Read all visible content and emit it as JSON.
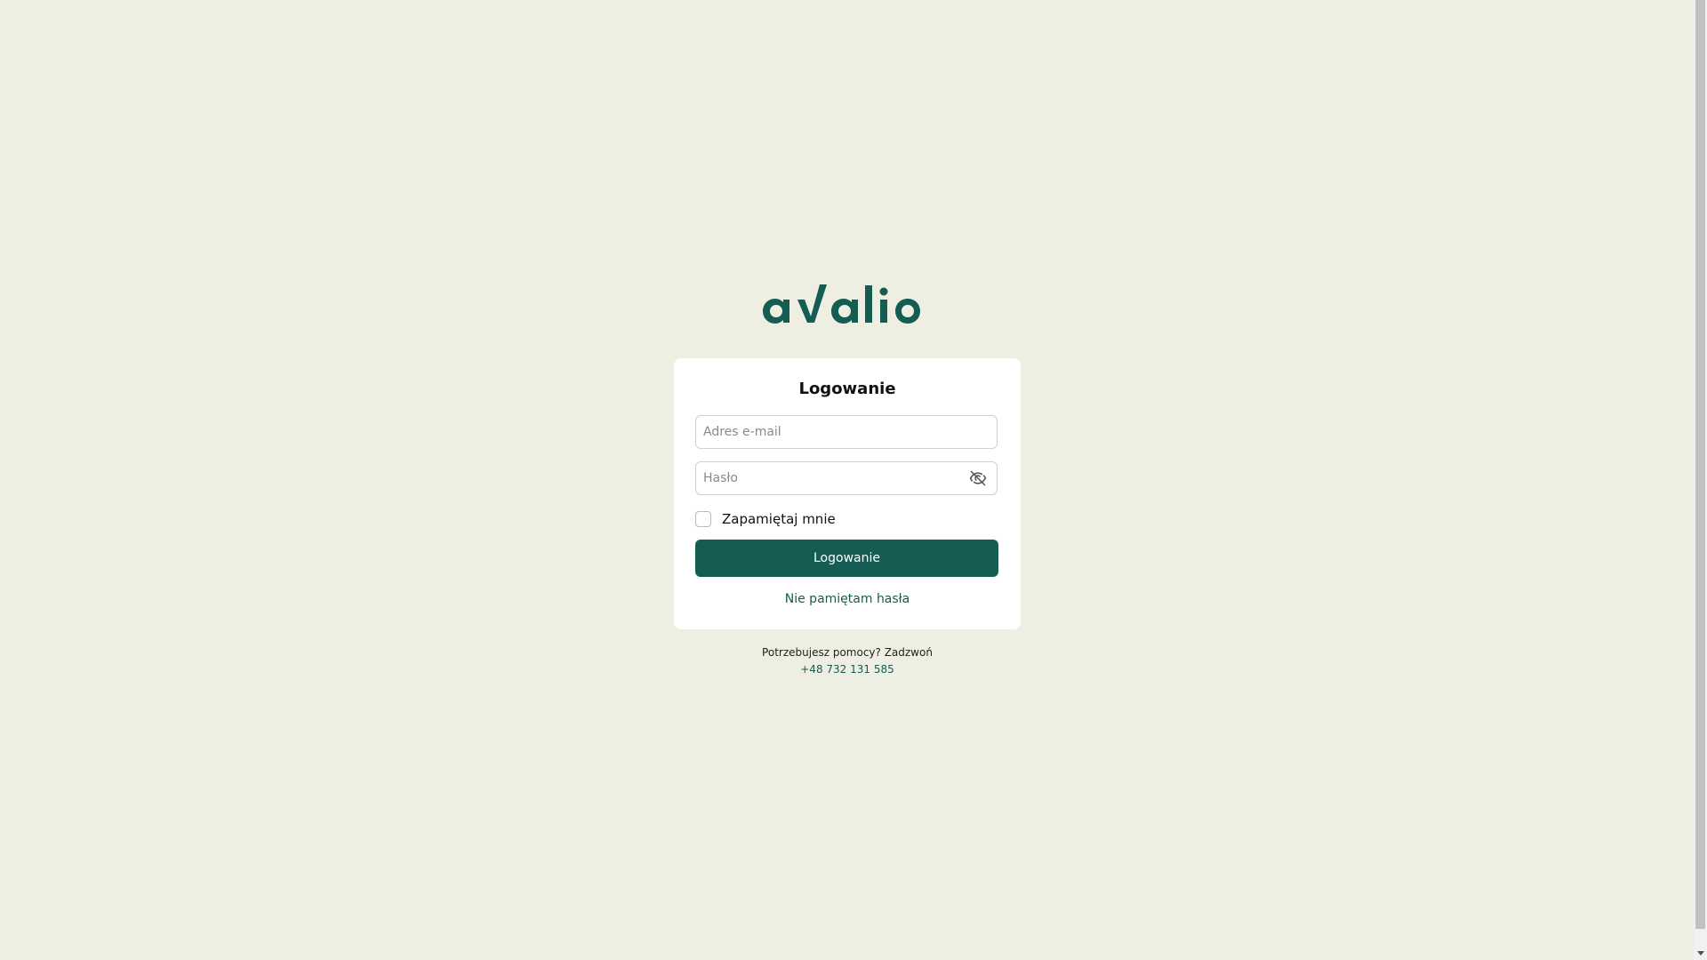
{
  "brand": {
    "logo_text": "avalio",
    "color": "#155d52"
  },
  "login_card": {
    "title": "Logowanie",
    "email_placeholder": "Adres e-mail",
    "email_value": "",
    "password_placeholder": "Hasło",
    "password_value": "",
    "password_toggle_icon": "eye-slash-icon",
    "remember_label": "Zapamiętaj mnie",
    "remember_checked": false,
    "submit_label": "Logowanie",
    "forgot_label": "Nie pamiętam hasła"
  },
  "help": {
    "text": "Potrzebujesz pomocy? Zadzwoń",
    "phone": "+48 732 131 585"
  },
  "colors": {
    "background": "#efeee3",
    "accent": "#155d52",
    "card": "#ffffff"
  }
}
